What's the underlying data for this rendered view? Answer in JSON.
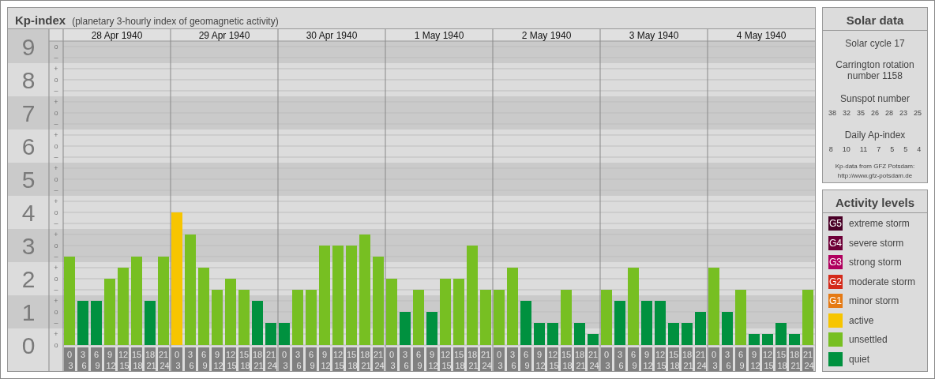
{
  "header": {
    "title": "Kp-index",
    "subtitle": "(planetary 3-hourly index of geomagnetic activity)"
  },
  "chart": {
    "days": [
      "28 Apr 1940",
      "29 Apr 1940",
      "30 Apr 1940",
      "1 May 1940",
      "2 May 1940",
      "3 May 1940",
      "4 May 1940"
    ],
    "subticks": [
      "o",
      "–",
      "+",
      "o",
      "–",
      "+",
      "o",
      "–",
      "+",
      "o",
      "–",
      "+",
      "o",
      "–",
      "+",
      "o",
      "–",
      "+",
      "o",
      "–",
      "+",
      "o",
      "–",
      "+",
      "o",
      "–",
      "+",
      "o"
    ],
    "chart_data": {
      "type": "bar",
      "stacked": true,
      "grid": true,
      "ylim": [
        0,
        9
      ],
      "yticks": [
        0,
        1,
        2,
        3,
        4,
        5,
        6,
        7,
        8,
        9
      ],
      "categories": [
        "0 3",
        "3 6",
        "6 9",
        "9 12",
        "12 15",
        "15 18",
        "18 21",
        "21 24",
        "0 3",
        "3 6",
        "6 9",
        "9 12",
        "12 15",
        "15 18",
        "18 21",
        "21 24",
        "0 3",
        "3 6",
        "6 9",
        "9 12",
        "12 15",
        "15 18",
        "18 21",
        "21 24",
        "0 3",
        "3 6",
        "6 9",
        "9 12",
        "12 15",
        "15 18",
        "18 21",
        "21 24",
        "0 3",
        "3 6",
        "6 9",
        "9 12",
        "12 15",
        "15 18",
        "18 21",
        "21 24",
        "0 3",
        "3 6",
        "6 9",
        "9 12",
        "12 15",
        "15 18",
        "18 21",
        "21 24",
        "0 3",
        "3 6",
        "6 9",
        "9 12",
        "12 15",
        "15 18",
        "18 21",
        "21 24"
      ],
      "series": [
        {
          "color": "#00913f",
          "values": [
            null,
            1.33,
            1.33,
            null,
            null,
            null,
            1.33,
            null,
            null,
            null,
            null,
            null,
            null,
            null,
            1.33,
            0.67,
            0.67,
            null,
            null,
            null,
            null,
            null,
            null,
            null,
            null,
            1,
            null,
            1,
            null,
            null,
            null,
            null,
            null,
            null,
            1.33,
            0.67,
            0.67,
            null,
            0.67,
            0.33,
            null,
            1.33,
            null,
            1.33,
            1.33,
            0.67,
            0.67,
            1,
            null,
            1,
            null,
            0.33,
            0.33,
            0.67,
            0.33,
            null
          ]
        },
        {
          "color": "#77bf22",
          "values": [
            2.67,
            null,
            null,
            2,
            2.33,
            2.67,
            null,
            2.67,
            null,
            3.33,
            2.33,
            1.67,
            2,
            1.67,
            null,
            null,
            null,
            1.67,
            1.67,
            3,
            3,
            3,
            3.33,
            2.67,
            2,
            null,
            1.67,
            null,
            2,
            2,
            3,
            1.67,
            1.67,
            2.33,
            null,
            null,
            null,
            1.67,
            null,
            null,
            1.67,
            null,
            2.33,
            null,
            null,
            null,
            null,
            null,
            2.33,
            null,
            1.67,
            null,
            null,
            null,
            null,
            1.67
          ]
        },
        {
          "color": "#f7c500",
          "values": [
            null,
            null,
            null,
            null,
            null,
            null,
            null,
            null,
            4,
            null,
            null,
            null,
            null,
            null,
            null,
            null,
            null,
            null,
            null,
            null,
            null,
            null,
            null,
            null,
            null,
            null,
            null,
            null,
            null,
            null,
            null,
            null,
            null,
            null,
            null,
            null,
            null,
            null,
            null,
            null,
            null,
            null,
            null,
            null,
            null,
            null,
            null,
            null,
            null,
            null,
            null,
            null,
            null,
            null,
            null,
            null
          ]
        }
      ]
    }
  },
  "solar_data": {
    "title": "Solar data",
    "solar_cycle": "Solar cycle 17",
    "carrington": "Carrington rotation number 1158",
    "sunspot_label": "Sunspot number",
    "sunspot_numbers": [
      "38",
      "32",
      "35",
      "26",
      "28",
      "23",
      "25"
    ],
    "ap_label": "Daily Ap-index",
    "ap_values": [
      "8",
      "10",
      "11",
      "7",
      "5",
      "5",
      "4"
    ],
    "source": "Kp-data from GFZ Potsdam:",
    "source_url": "http://www.gfz-potsdam.de"
  },
  "activity_levels": {
    "title": "Activity levels",
    "items": [
      {
        "badge": "G5",
        "label": "extreme storm",
        "color": "#4a0027"
      },
      {
        "badge": "G4",
        "label": "severe storm",
        "color": "#6e0038"
      },
      {
        "badge": "G3",
        "label": "strong storm",
        "color": "#b0005e"
      },
      {
        "badge": "G2",
        "label": "moderate storm",
        "color": "#d42a1a"
      },
      {
        "badge": "G1",
        "label": "minor storm",
        "color": "#e57a14"
      },
      {
        "label": "active",
        "color": "#f7c500"
      },
      {
        "label": "unsettled",
        "color": "#77bf22"
      },
      {
        "label": "quiet",
        "color": "#00913f"
      }
    ]
  }
}
